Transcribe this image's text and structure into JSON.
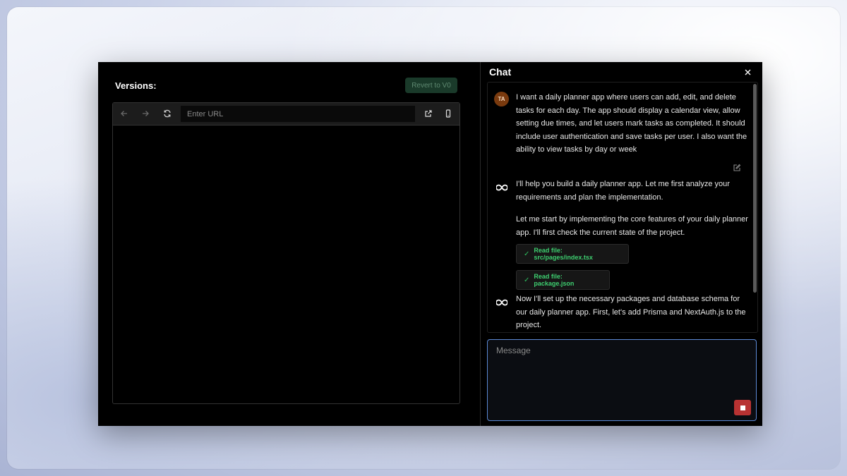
{
  "left_panel": {
    "versions_label": "Versions:",
    "revert_button": "Revert to V0",
    "browser": {
      "url_placeholder": "Enter URL",
      "url_value": "",
      "icons": [
        "arrow-left-icon",
        "arrow-right-icon",
        "refresh-icon",
        "external-link-icon",
        "mobile-icon"
      ]
    }
  },
  "chat": {
    "title": "Chat",
    "messages": [
      {
        "role": "user",
        "avatar_initials": "TA",
        "text": "I want a daily planner app where users can add, edit, and delete tasks for each day. The app should display a calendar view, allow setting due times, and let users mark tasks as completed. It should include user authentication and save tasks per user. I also want the ability to view tasks by day or week"
      },
      {
        "role": "assistant",
        "text": "I'll help you build a daily planner app. Let me first analyze your requirements and plan the implementation."
      },
      {
        "role": "assistant",
        "text": "Let me start by implementing the core features of your daily planner app. I'll first check the current state of the project."
      },
      {
        "role": "tool",
        "text": "Read file: src/pages/index.tsx"
      },
      {
        "role": "tool",
        "text": "Read file: package.json"
      },
      {
        "role": "assistant",
        "text": "Now I'll set up the necessary packages and database schema for our daily planner app. First, let's add Prisma and NextAuth.js to the project."
      }
    ],
    "input_placeholder": "Message",
    "input_value": ""
  },
  "colors": {
    "accent_border": "#5c8ad6",
    "stop_button": "#b83232",
    "success_green": "#3ecf70",
    "avatar_bg": "#7a3a0e"
  }
}
